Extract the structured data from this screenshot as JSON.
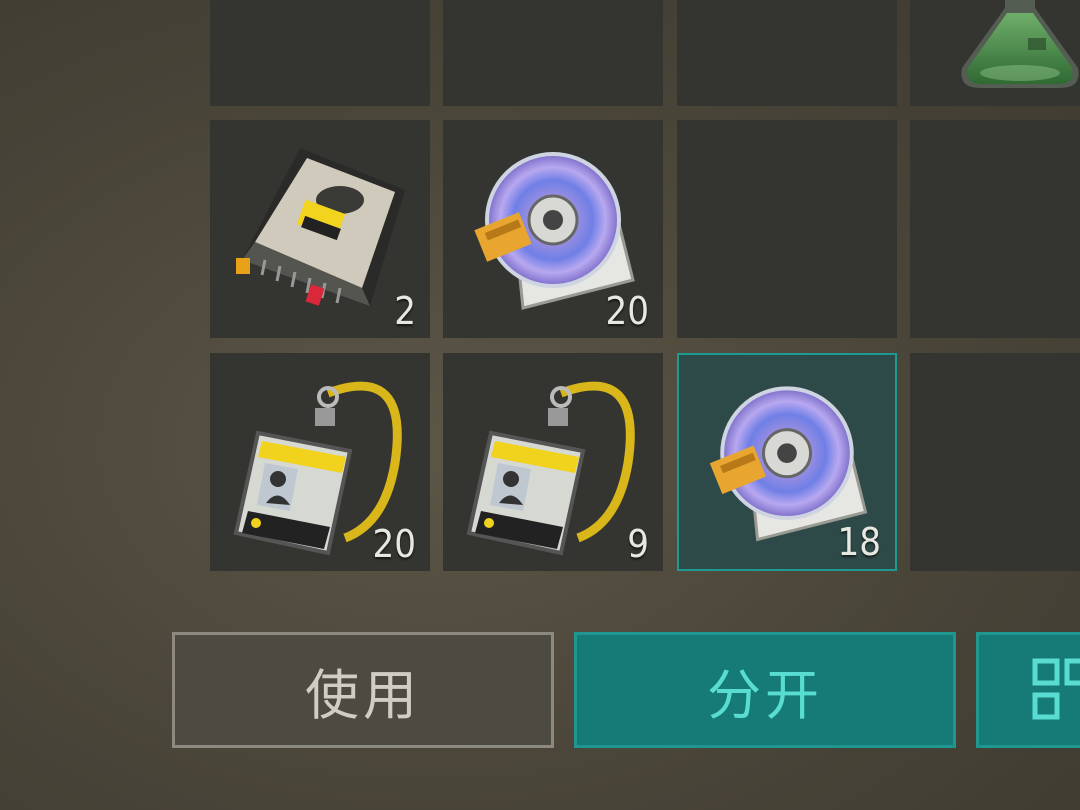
{
  "inventory": {
    "slots": [
      {
        "item": "",
        "count": ""
      },
      {
        "item": "",
        "count": ""
      },
      {
        "item": "",
        "count": ""
      },
      {
        "item": "flask",
        "count": ""
      },
      {
        "item": "hard-drive",
        "count": "2"
      },
      {
        "item": "disc",
        "count": "20"
      },
      {
        "item": "",
        "count": ""
      },
      {
        "item": "",
        "count": ""
      },
      {
        "item": "keycard",
        "count": "20"
      },
      {
        "item": "keycard",
        "count": "9"
      },
      {
        "item": "disc",
        "count": "18",
        "selected": true
      },
      {
        "item": "",
        "count": ""
      }
    ]
  },
  "actions": {
    "use_label": "使用",
    "split_label": "分开",
    "more_icon": "grid-icon"
  },
  "colors": {
    "accent": "#167a76",
    "accent_text": "#59dcd2",
    "selected_border": "#1f9a93"
  }
}
